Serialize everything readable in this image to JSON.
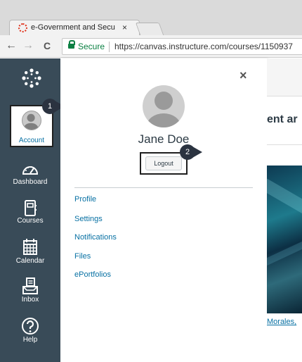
{
  "browser": {
    "tab_title": "e-Government and Secu",
    "tab_close": "×",
    "nav_back": "←",
    "nav_forward": "→",
    "nav_reload": "C",
    "secure_label": "Secure",
    "url": "https://canvas.instructure.com/courses/1150937"
  },
  "global_nav": {
    "account_label": "Account",
    "items": [
      {
        "label": "Dashboard",
        "icon": "dashboard-icon"
      },
      {
        "label": "Courses",
        "icon": "courses-icon"
      },
      {
        "label": "Calendar",
        "icon": "calendar-icon"
      },
      {
        "label": "Inbox",
        "icon": "inbox-icon"
      },
      {
        "label": "Help",
        "icon": "help-icon"
      }
    ],
    "colors": {
      "nav_bg": "#394b58",
      "link": "#0770a3"
    }
  },
  "callouts": {
    "one": "1",
    "two": "2"
  },
  "tray": {
    "close": "×",
    "user_name": "Jane Doe",
    "logout_label": "Logout",
    "links": [
      "Profile",
      "Settings",
      "Notifications",
      "Files",
      "ePortfolios"
    ]
  },
  "page": {
    "title_fragment": "ent ar",
    "credit_fragment": "Morales,"
  }
}
